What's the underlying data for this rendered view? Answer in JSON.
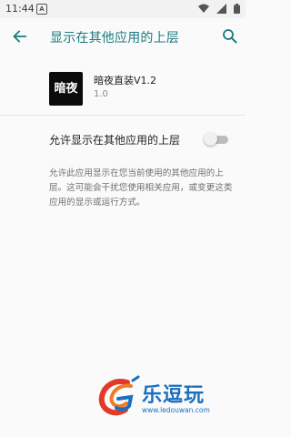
{
  "status_bar": {
    "time": "11:44",
    "notification_glyph": "A",
    "icons": [
      "wifi-icon",
      "signal-icon",
      "battery-icon"
    ]
  },
  "app_bar": {
    "title": "显示在其他应用的上层",
    "back_icon": "arrow-left-icon",
    "search_icon": "search-icon"
  },
  "app_info": {
    "icon_text": "暗夜",
    "name": "暗夜直装V1.2",
    "version": "1.0"
  },
  "permission": {
    "label": "允许显示在其他应用的上层",
    "enabled": false
  },
  "description": "允许此应用显示在您当前使用的其他应用的上层。这可能会干扰您使用相关应用，或变更这类应用的显示或运行方式。",
  "watermark": {
    "title": "乐逗玩",
    "url": "www.ledouwan.com"
  },
  "colors": {
    "accent": "#1b7a7f",
    "background": "#fafafa",
    "watermark_blue": "#1a6fbf",
    "watermark_red": "#e23a2a"
  }
}
